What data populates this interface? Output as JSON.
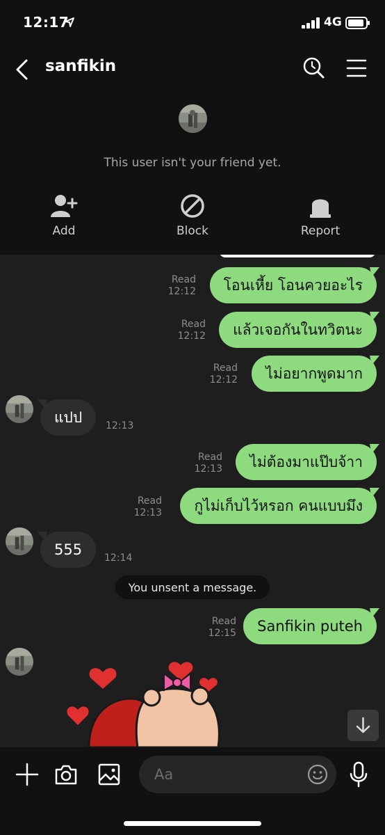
{
  "status_bar": {
    "time": "12:17",
    "network": "4G",
    "location_icon": "location-arrow-icon",
    "signal_icon": "signal-bars-icon",
    "battery_icon": "battery-icon"
  },
  "header": {
    "chat_name": "sanfikin",
    "notice": "This user isn't your friend yet.",
    "actions": [
      {
        "label": "Add",
        "icon": "add-friend-icon"
      },
      {
        "label": "Block",
        "icon": "block-icon"
      },
      {
        "label": "Report",
        "icon": "report-icon"
      }
    ]
  },
  "messages": [
    {
      "side": "out",
      "text": "โอนเหี้ย โอนควยอะไร",
      "status": "Read",
      "time": "12:12"
    },
    {
      "side": "out",
      "text": "แล้วเจอกันในทวิตนะ",
      "status": "Read",
      "time": "12:12"
    },
    {
      "side": "out",
      "text": "ไม่อยากพูดมาก",
      "status": "Read",
      "time": "12:12"
    },
    {
      "side": "in",
      "text": "แปป",
      "time": "12:13"
    },
    {
      "side": "out",
      "text": "ไม่ต้องมาแป๊บจ้าา",
      "status": "Read",
      "time": "12:13"
    },
    {
      "side": "out",
      "text": "กูไม่เก็บไว้หรอก คนแบบมึง",
      "status": "Read",
      "time": "12:13"
    },
    {
      "side": "in",
      "text": "555",
      "time": "12:14"
    },
    {
      "side": "system",
      "text": "You unsent a message."
    },
    {
      "side": "out",
      "text": "Sanfikin puteh",
      "status": "Read",
      "time": "12:15"
    }
  ],
  "input": {
    "placeholder": "Aa"
  },
  "colors": {
    "outgoing_bubble": "#8ddb7e",
    "incoming_bubble": "#2d2d2d",
    "background": "#1e1e1e",
    "header": "#111111"
  }
}
